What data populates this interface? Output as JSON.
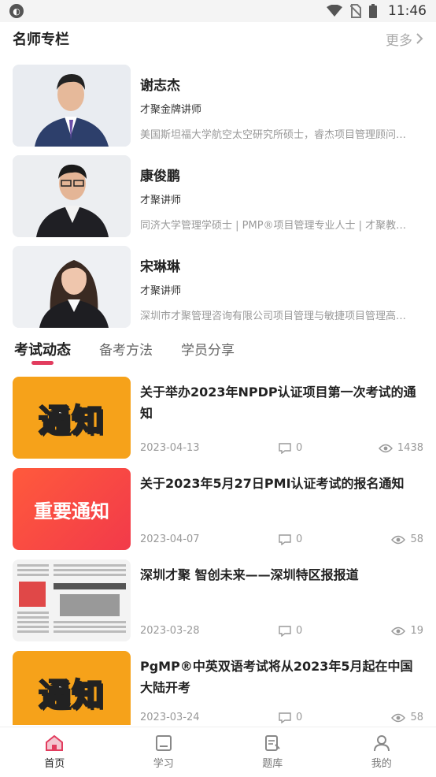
{
  "status": {
    "time": "11:46"
  },
  "famous": {
    "title": "名师专栏",
    "more": "更多"
  },
  "teachers": [
    {
      "name": "谢志杰",
      "title": "才聚金牌讲师",
      "desc": "美国斯坦福大学航空太空研究所硕士，睿杰项目管理顾问…"
    },
    {
      "name": "康俊鹏",
      "title": "才聚讲师",
      "desc": "同济大学管理学硕士 | PMP®项目管理专业人士 | 才聚教…"
    },
    {
      "name": "宋琳琳",
      "title": "才聚讲师",
      "desc": "深圳市才聚管理咨询有限公司项目管理与敏捷项目管理高…"
    }
  ],
  "tabs": [
    "考试动态",
    "备考方法",
    "学员分享"
  ],
  "news": [
    {
      "title": "关于举办2023年NPDP认证项目第一次考试的通知",
      "date": "2023-04-13",
      "comments": "0",
      "views": "1438",
      "thumb_text": "通知"
    },
    {
      "title": "关于2023年5月27日PMI认证考试的报名通知",
      "date": "2023-04-07",
      "comments": "0",
      "views": "58",
      "thumb_text": "重要通知"
    },
    {
      "title": "深圳才聚 智创未来——深圳特区报报道",
      "date": "2023-03-28",
      "comments": "0",
      "views": "19",
      "thumb_text": ""
    },
    {
      "title": "PgMP®中英双语考试将从2023年5月起在中国大陆开考",
      "date": "2023-03-24",
      "comments": "0",
      "views": "58",
      "thumb_text": "通知"
    }
  ],
  "nav": [
    {
      "label": "首页",
      "icon": "home-icon"
    },
    {
      "label": "学习",
      "icon": "book-icon"
    },
    {
      "label": "题库",
      "icon": "question-bank-icon"
    },
    {
      "label": "我的",
      "icon": "user-icon"
    }
  ],
  "colors": {
    "accent": "#e23c5e",
    "notice_orange": "#f6a21a",
    "important_red": "#f23a4a"
  }
}
